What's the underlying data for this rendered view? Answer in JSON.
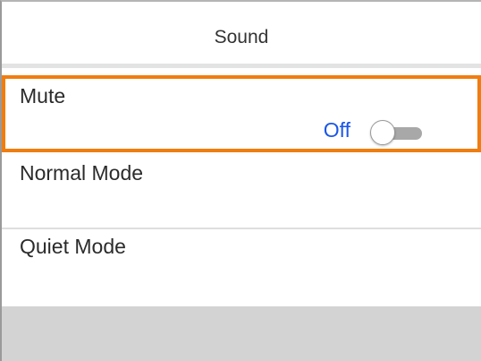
{
  "header": {
    "title": "Sound"
  },
  "settings": {
    "mute": {
      "label": "Mute",
      "value": "Off",
      "toggle_on": false
    },
    "items": [
      {
        "label": "Normal Mode"
      },
      {
        "label": "Quiet Mode"
      }
    ]
  },
  "colors": {
    "selection_border": "#f07d10",
    "value_text": "#1b57e6",
    "toggle_track": "#a8a8a8",
    "bottom_bar": "#d3d3d3"
  }
}
